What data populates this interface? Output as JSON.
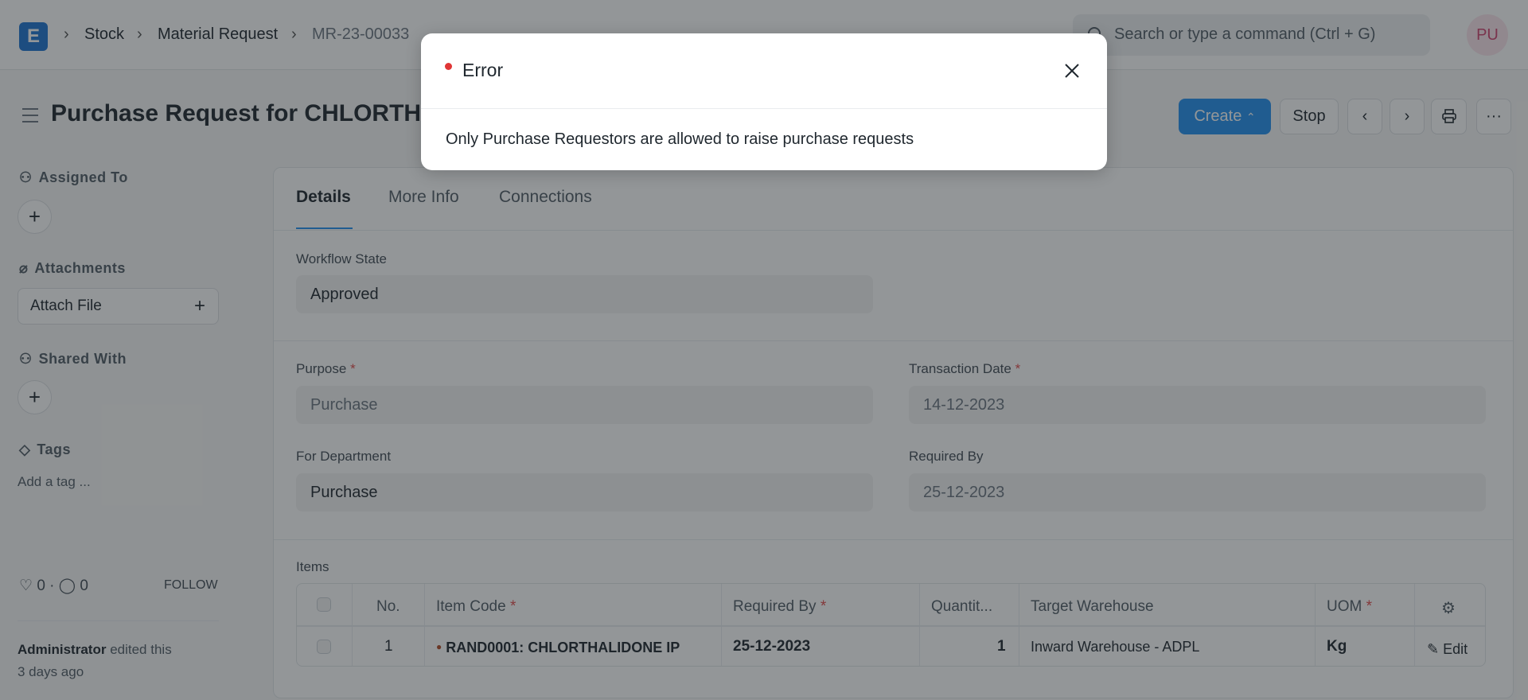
{
  "navbar": {
    "logo": "E",
    "breadcrumbs": [
      "Stock",
      "Material Request",
      "MR-23-00033"
    ],
    "search_placeholder": "Search or type a command (Ctrl + G)",
    "avatar": "PU"
  },
  "page": {
    "title": "Purchase Request for CHLORTHALIDONE IP",
    "buttons": {
      "create": "Create",
      "stop": "Stop"
    }
  },
  "sidebar": {
    "assigned_to": "Assigned To",
    "attachments": "Attachments",
    "attach_file": "Attach File",
    "shared_with": "Shared With",
    "tags": "Tags",
    "add_tag": "Add a tag ...",
    "likes": "0",
    "comments": "0",
    "follow": "FOLLOW",
    "activity_user": "Administrator",
    "activity_action": " edited this",
    "activity_time": "3 days ago"
  },
  "tabs": [
    "Details",
    "More Info",
    "Connections"
  ],
  "form": {
    "workflow_state": {
      "label": "Workflow State",
      "value": "Approved"
    },
    "purpose": {
      "label": "Purpose",
      "value": "Purchase"
    },
    "transaction_date": {
      "label": "Transaction Date",
      "value": "14-12-2023"
    },
    "for_department": {
      "label": "For Department",
      "value": "Purchase"
    },
    "required_by": {
      "label": "Required By",
      "value": "25-12-2023"
    }
  },
  "items": {
    "label": "Items",
    "headers": [
      "No.",
      "Item Code",
      "Required By",
      "Quantit...",
      "Target Warehouse",
      "UOM"
    ],
    "rows": [
      {
        "no": "1",
        "item_code": "RAND0001: CHLORTHALIDONE IP",
        "required_by": "25-12-2023",
        "qty": "1",
        "warehouse": "Inward Warehouse - ADPL",
        "uom": "Kg",
        "edit": "Edit"
      }
    ]
  },
  "modal": {
    "title": "Error",
    "message": "Only Purchase Requestors are allowed to raise purchase requests",
    "indicator_color": "#e03636"
  },
  "colors": {
    "primary": "#2490ef",
    "required": "#e24c4c"
  }
}
